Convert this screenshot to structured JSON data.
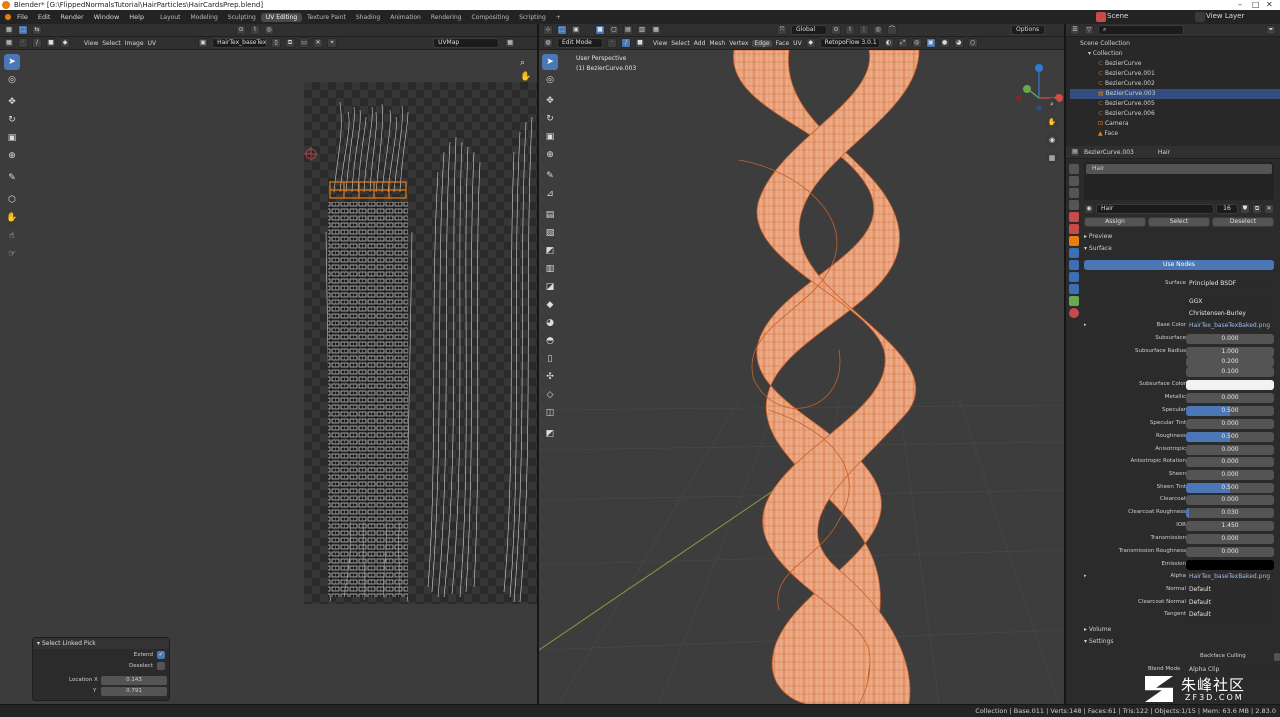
{
  "window": {
    "title": "Blender* [G:\\FlippedNormalsTutorial\\HairParticles\\HairCardsPrep.blend]"
  },
  "menus": [
    "File",
    "Edit",
    "Render",
    "Window",
    "Help"
  ],
  "workspaces": [
    "Layout",
    "Modeling",
    "Sculpting",
    "UV Editing",
    "Texture Paint",
    "Shading",
    "Animation",
    "Rendering",
    "Compositing",
    "Scripting"
  ],
  "active_workspace": "UV Editing",
  "scene": {
    "name": "Scene",
    "view_layer": "View Layer"
  },
  "uv_editor": {
    "header_items": [
      "View",
      "Select",
      "Image",
      "UV"
    ],
    "image_name": "HairTex_baseTexBak...",
    "uv_map": "UVMap"
  },
  "viewport": {
    "mode": "Edit Mode",
    "header_items": [
      "View",
      "Select",
      "Add",
      "Mesh",
      "Vertex",
      "Edge",
      "Face",
      "UV"
    ],
    "active_menu": "Edge",
    "orientation": "Global",
    "addon": "RetopoFlow 3.0.1",
    "options": "Options",
    "info_line1": "User Perspective",
    "info_line2": "(1) BezierCurve.003"
  },
  "operator_panel": {
    "title": "Select Linked Pick",
    "extend_label": "Extend",
    "extend_checked": true,
    "deselect_label": "Deselect",
    "deselect_checked": false,
    "location_x_label": "Location X",
    "location_x": "0.143",
    "y_label": "Y",
    "y": "0.791"
  },
  "outliner": {
    "scene_collection": "Scene Collection",
    "collection": "Collection",
    "items": [
      "BezierCurve",
      "BezierCurve.001",
      "BezierCurve.002",
      "BezierCurve.003",
      "BezierCurve.005",
      "BezierCurve.006",
      "Camera",
      "Face"
    ],
    "selected_index": 3
  },
  "properties": {
    "object_name": "BezierCurve.003",
    "material_name": "Hair",
    "slot_name": "Hair",
    "material_field": "Hair",
    "user_count": "16",
    "assign": "Assign",
    "select": "Select",
    "deselect": "Deselect",
    "preview": "Preview",
    "surface_section": "Surface",
    "use_nodes": "Use Nodes",
    "surface_label": "Surface",
    "surface_value": "Principled BSDF",
    "distribution": "GGX",
    "subsurface_method": "Christensen-Burley",
    "rows": [
      {
        "label": "Base Color",
        "value": "HairTex_baseTexBaked.png",
        "kind": "image"
      },
      {
        "label": "Subsurface",
        "value": "0.000",
        "kind": "num",
        "fill": 0
      },
      {
        "label": "Subsurface Radius",
        "value": "1.000",
        "kind": "num",
        "fill": 0
      },
      {
        "label": "",
        "value": "0.200",
        "kind": "num",
        "fill": 0
      },
      {
        "label": "",
        "value": "0.100",
        "kind": "num",
        "fill": 0
      },
      {
        "label": "Subsurface Color",
        "value": "",
        "kind": "color",
        "color": "#f2f2f2"
      },
      {
        "label": "Metallic",
        "value": "0.000",
        "kind": "num",
        "fill": 0
      },
      {
        "label": "Specular",
        "value": "0.500",
        "kind": "num",
        "fill": 0.5
      },
      {
        "label": "Specular Tint",
        "value": "0.000",
        "kind": "num",
        "fill": 0
      },
      {
        "label": "Roughness",
        "value": "0.500",
        "kind": "num",
        "fill": 0.5
      },
      {
        "label": "Anisotropic",
        "value": "0.000",
        "kind": "num",
        "fill": 0
      },
      {
        "label": "Anisotropic Rotation",
        "value": "0.000",
        "kind": "num",
        "fill": 0
      },
      {
        "label": "Sheen",
        "value": "0.000",
        "kind": "num",
        "fill": 0
      },
      {
        "label": "Sheen Tint",
        "value": "0.500",
        "kind": "num",
        "fill": 0.5
      },
      {
        "label": "Clearcoat",
        "value": "0.000",
        "kind": "num",
        "fill": 0
      },
      {
        "label": "Clearcoat Roughness",
        "value": "0.030",
        "kind": "num",
        "fill": 0.03
      },
      {
        "label": "IOR",
        "value": "1.450",
        "kind": "num",
        "fill": 0
      },
      {
        "label": "Transmission",
        "value": "0.000",
        "kind": "num",
        "fill": 0
      },
      {
        "label": "Transmission Roughness",
        "value": "0.000",
        "kind": "num",
        "fill": 0
      },
      {
        "label": "Emission",
        "value": "",
        "kind": "color",
        "color": "#000000"
      },
      {
        "label": "Alpha",
        "value": "HairTex_baseTexBaked.png",
        "kind": "image"
      },
      {
        "label": "Normal",
        "value": "Default",
        "kind": "dark"
      },
      {
        "label": "Clearcoat Normal",
        "value": "Default",
        "kind": "dark"
      },
      {
        "label": "Tangent",
        "value": "Default",
        "kind": "dark"
      }
    ],
    "volume_section": "Volume",
    "settings_section": "Settings",
    "backface_culling": "Backface Culling",
    "blend_mode_label": "Blend Mode",
    "blend_mode": "Alpha Clip"
  },
  "statusbar": {
    "text": "Collection | Base.011 | Verts:148 | Faces:61 | Tris:122 | Objects:1/15 | Mem: 63.6 MB | 2.83.0"
  },
  "watermark": {
    "brand": "朱峰社区",
    "url": "ZF3D.COM"
  },
  "colors": {
    "accent": "#4b77b6",
    "mesh": "#e9a27c",
    "wire": "#e0701c",
    "selected_edge": "#e87d0d"
  },
  "icons": [
    "select-icon",
    "cursor-icon",
    "move-icon",
    "rotate-icon",
    "scale-icon",
    "transform-icon",
    "annotate-icon",
    "measure-icon",
    "zoom-icon",
    "hand-icon",
    "camera-icon",
    "grid-icon"
  ]
}
